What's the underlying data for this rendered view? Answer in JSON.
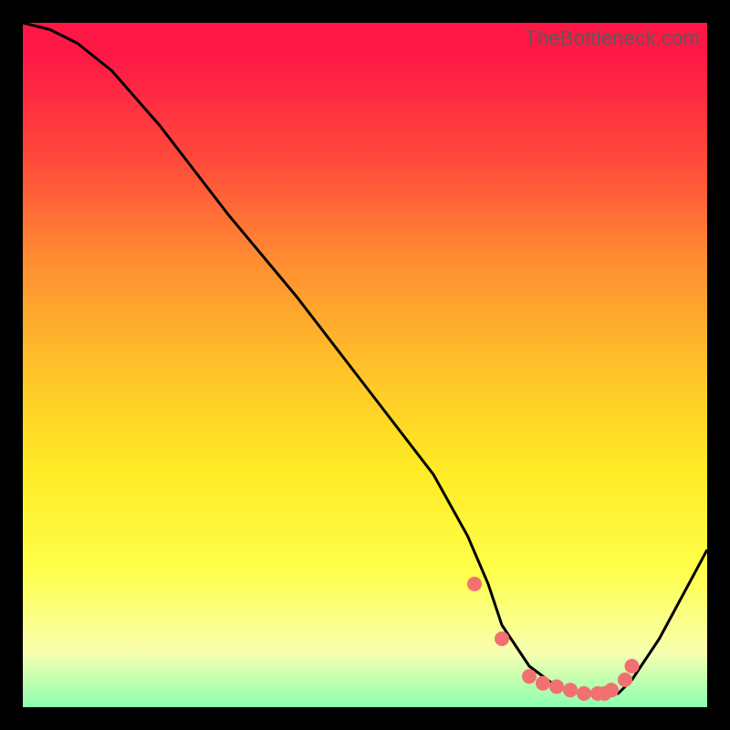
{
  "watermark": "TheBottleneck.com",
  "chart_data": {
    "type": "line",
    "title": "",
    "xlabel": "",
    "ylabel": "",
    "xlim": [
      0,
      100
    ],
    "ylim": [
      0,
      100
    ],
    "series": [
      {
        "name": "bottleneck-curve",
        "x": [
          0,
          4,
          8,
          13,
          20,
          30,
          40,
          50,
          60,
          65,
          68,
          70,
          74,
          78,
          82,
          85,
          87,
          89,
          93,
          100
        ],
        "y": [
          100,
          99,
          97,
          93,
          85,
          72,
          60,
          47,
          34,
          25,
          18,
          12,
          6,
          3,
          2,
          2,
          2,
          4,
          10,
          23
        ]
      }
    ],
    "markers": {
      "name": "highlight-points",
      "x": [
        66,
        70,
        74,
        76,
        78,
        80,
        82,
        84,
        85,
        86,
        88,
        89
      ],
      "y": [
        18,
        10,
        4.5,
        3.5,
        3,
        2.5,
        2,
        2,
        2,
        2.5,
        4,
        6
      ]
    }
  },
  "colors": {
    "curve": "#000000",
    "marker": "#f27070"
  }
}
